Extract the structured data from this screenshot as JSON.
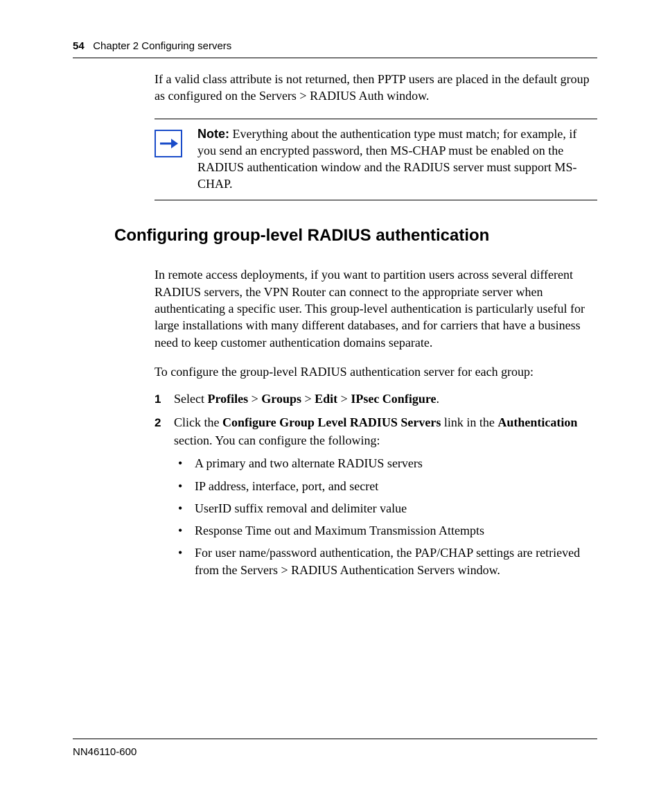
{
  "header": {
    "page_number": "54",
    "chapter": "Chapter 2  Configuring servers"
  },
  "intro_para": "If a valid class attribute is not returned, then PPTP users are placed in the default group as configured on the Servers > RADIUS Auth window.",
  "note": {
    "label": "Note:",
    "text": " Everything about the authentication type must match; for example, if you send an encrypted password, then MS-CHAP must be enabled on the RADIUS authentication window and the RADIUS server must support MS-CHAP."
  },
  "section_heading": "Configuring group-level RADIUS authentication",
  "section_para1": "In remote access deployments, if you want to partition users across several different RADIUS servers, the VPN Router can connect to the appropriate server when authenticating a specific user. This group-level authentication is particularly useful for large installations with many different databases, and for carriers that have a business need to keep customer authentication domains separate.",
  "section_para2": "To configure the group-level RADIUS authentication server for each group:",
  "steps": [
    {
      "num": "1",
      "pre": "Select ",
      "bold1": "Profiles",
      "mid1": " > ",
      "bold2": "Groups",
      "mid2": " > ",
      "bold3": "Edit",
      "mid3": " > ",
      "bold4": "IPsec Configure",
      "post": "."
    },
    {
      "num": "2",
      "pre": "Click the ",
      "bold1": "Configure Group Level RADIUS Servers",
      "mid1": " link in the ",
      "bold2": "Authentication",
      "post": " section. You can configure the following:"
    }
  ],
  "bullets": [
    "A primary and two alternate RADIUS servers",
    "IP address, interface, port, and secret",
    "UserID suffix removal and delimiter value",
    "Response Time out and Maximum Transmission Attempts",
    "For user name/password authentication, the PAP/CHAP settings are retrieved from the Servers > RADIUS Authentication Servers window."
  ],
  "footer": "NN46110-600"
}
